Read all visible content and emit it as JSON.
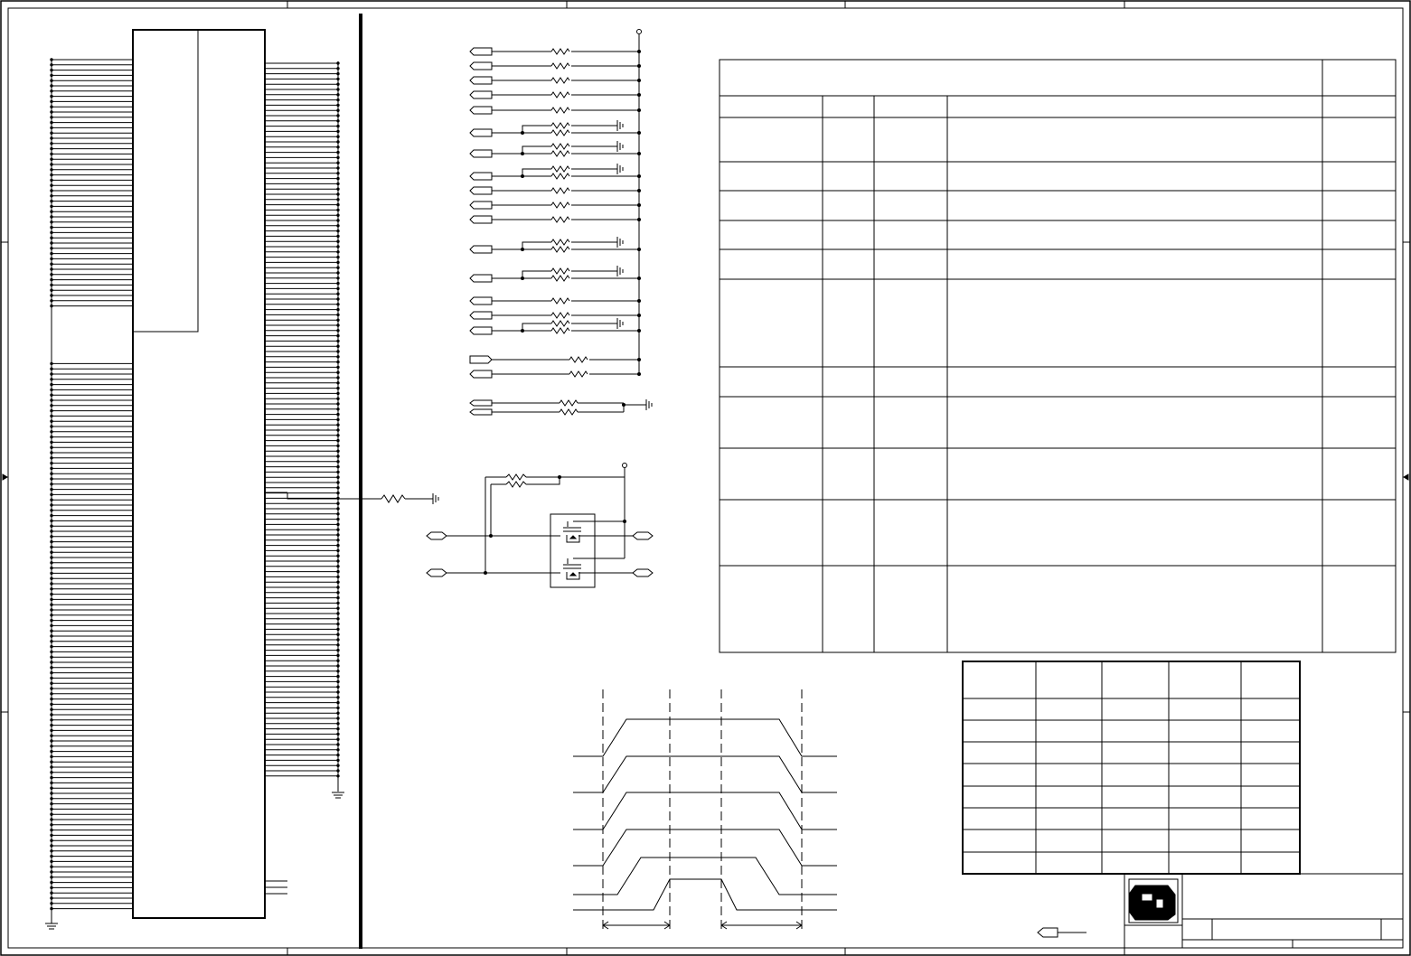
{
  "sheet": {
    "title": "",
    "description": ""
  },
  "colors": {
    "ink": "#000000",
    "paper": "#ffffff"
  },
  "connector": {
    "left_pin_count": 165,
    "right_pin_count": 138
  },
  "signal_table": {
    "header": "",
    "columns": [
      "",
      "",
      "",
      "",
      ""
    ],
    "row_count": 11
  },
  "voltage_table": {
    "columns": [
      "",
      "",
      "",
      "",
      ""
    ],
    "row_count": 8
  },
  "timing_diagram": {
    "signal_count": 5
  },
  "title_block": {
    "logo_icon": "company-logo-icon",
    "sheet_label": ""
  }
}
